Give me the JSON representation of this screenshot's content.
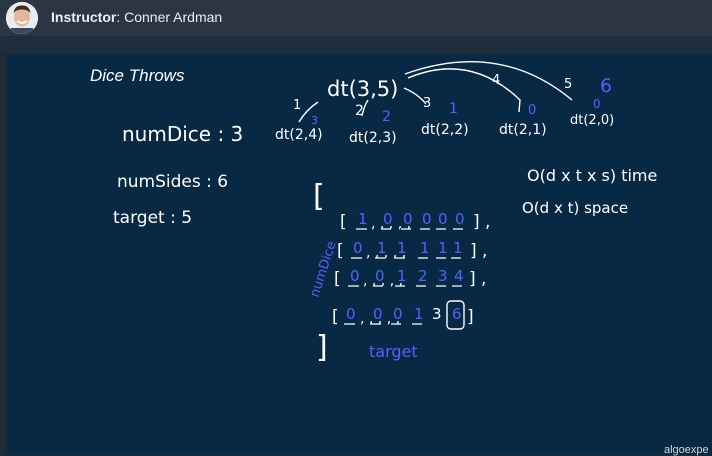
{
  "header": {
    "role_label": "Instructor",
    "name": ": Conner Ardman"
  },
  "board": {
    "title": "Dice Throws",
    "givens": {
      "num_dice": "numDice : 3",
      "num_sides": "numSides : 6",
      "target": "target  : 5"
    },
    "tree": {
      "root": "dt(3,5)",
      "children": [
        "dt(2,4)",
        "dt(2,3)",
        "dt(2,2)",
        "dt(2,1)",
        "dt(2,0)"
      ],
      "edge_labels": [
        "1",
        "2",
        "3",
        "4",
        "5"
      ],
      "child_results": [
        "3",
        "2",
        "1",
        "0",
        "0"
      ],
      "extra_result": "6"
    },
    "complexity": {
      "time": "O(d x t x s) time",
      "space": "O(d x t) space"
    },
    "table": {
      "open_bracket": "[",
      "close_bracket": "]",
      "rows": [
        [
          "1",
          "0",
          "0",
          "0",
          "0",
          "0"
        ],
        [
          "0",
          "1",
          "1",
          "1",
          "1",
          "1"
        ],
        [
          "0",
          "0",
          "1",
          "2",
          "3",
          "4"
        ],
        [
          "0",
          "0",
          "0",
          "1",
          "3",
          "6"
        ]
      ],
      "row_axis_label": "numDice",
      "col_axis_label": "target"
    },
    "watermark": "algoexpe"
  }
}
